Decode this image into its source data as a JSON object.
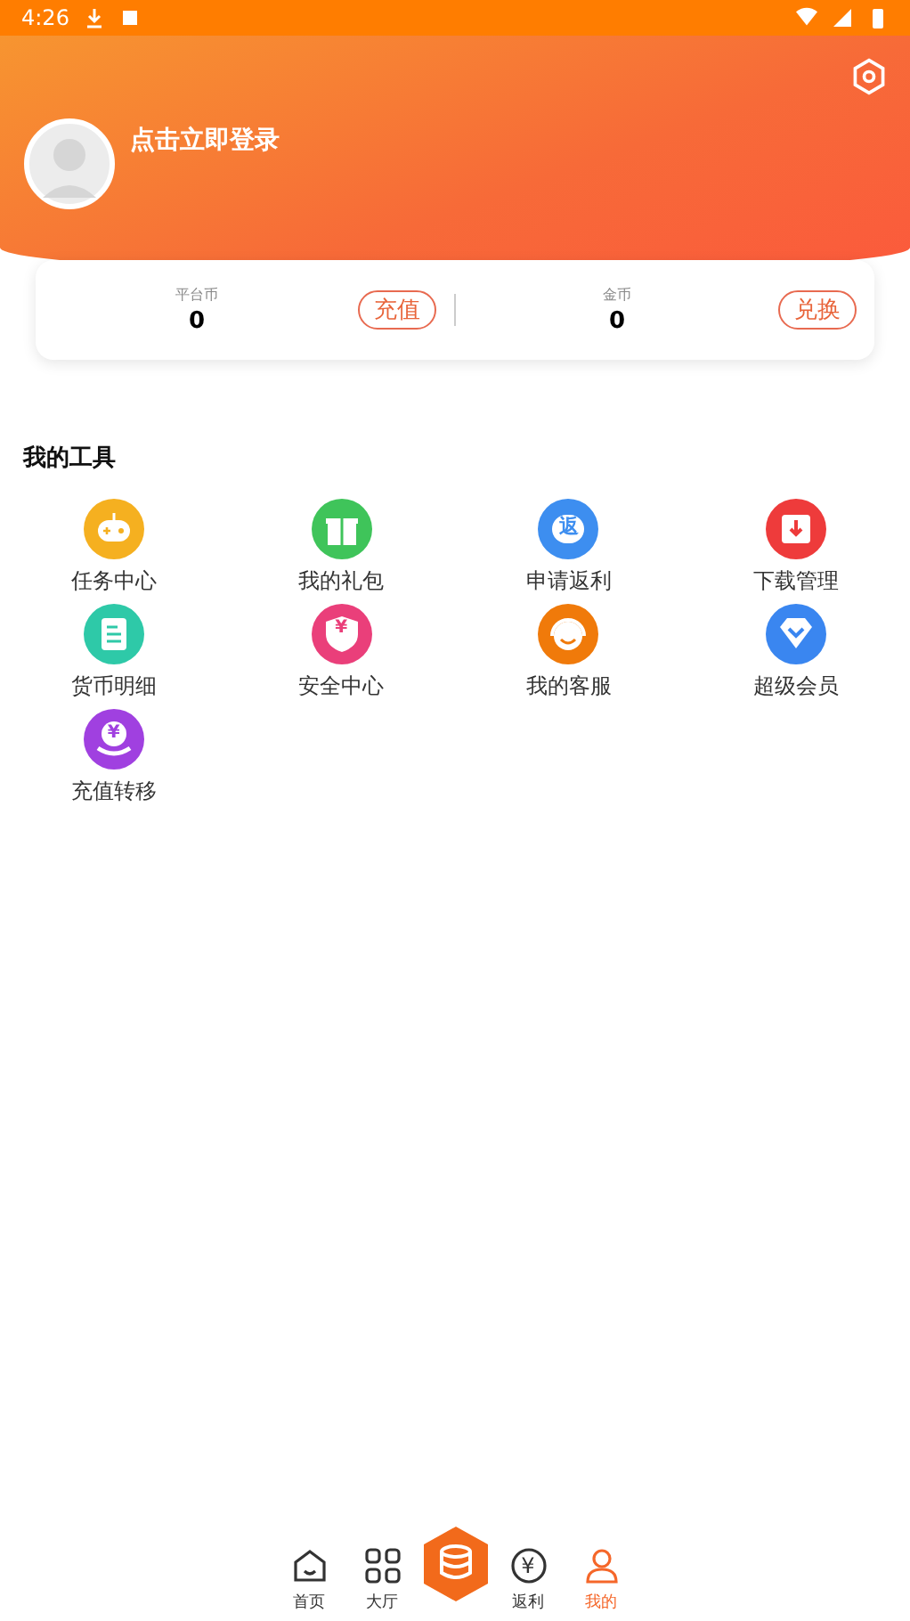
{
  "status_bar": {
    "time": "4:26"
  },
  "profile": {
    "login_text": "点击立即登录"
  },
  "wallet": [
    {
      "label": "平台币",
      "value": "0",
      "action": "充值"
    },
    {
      "label": "金币",
      "value": "0",
      "action": "兑换"
    }
  ],
  "tools": {
    "title": "我的工具",
    "items": [
      {
        "label": "任务中心",
        "kind": "gamepad",
        "color": "#f5b020"
      },
      {
        "label": "我的礼包",
        "kind": "gift",
        "color": "#3fc45a"
      },
      {
        "label": "申请返利",
        "kind": "rebate",
        "color": "#3d8ef0",
        "icon_char": "返"
      },
      {
        "label": "下载管理",
        "kind": "download",
        "color": "#ee3b3b"
      },
      {
        "label": "货币明细",
        "kind": "list",
        "color": "#2ec9a8"
      },
      {
        "label": "安全中心",
        "kind": "shield",
        "color": "#ea3f7a",
        "icon_char": "¥"
      },
      {
        "label": "我的客服",
        "kind": "headset",
        "color": "#f07a0a"
      },
      {
        "label": "超级会员",
        "kind": "diamond",
        "color": "#3a86f0"
      },
      {
        "label": "充值转移",
        "kind": "transfer",
        "color": "#a040e0",
        "icon_char": "¥"
      }
    ]
  },
  "nav": [
    {
      "label": "首页",
      "kind": "home",
      "selected": false
    },
    {
      "label": "大厅",
      "kind": "grid",
      "selected": false
    },
    {
      "kind": "center",
      "selected": false
    },
    {
      "label": "返利",
      "kind": "yuan",
      "selected": false,
      "icon_char": "¥"
    },
    {
      "label": "我的",
      "kind": "user",
      "selected": true
    }
  ]
}
